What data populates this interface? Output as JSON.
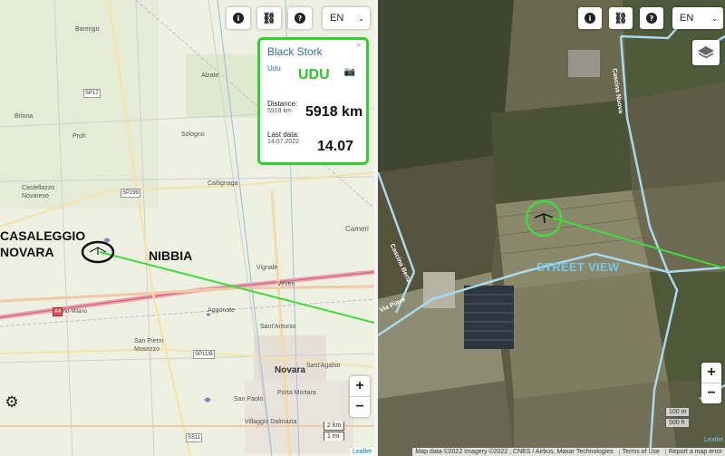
{
  "left_map": {
    "controls": {
      "lang": "EN",
      "zoom_in": "+",
      "zoom_out": "−"
    },
    "places": {
      "barengo": "Barengo",
      "alzate": "Alzate",
      "briona": "Briona",
      "proh": "Proh",
      "sologno": "Sologno",
      "caltignaga": "Caltignaga",
      "castellazzo": "Castellazzo\nNovarese",
      "vignale": "Vignale",
      "veveri": "Veveri",
      "aggonate": "Aggonate",
      "santantonio": "Sant'Antonio",
      "sanpietro": "San Pietro\nMosezzo",
      "novara": "Novara",
      "santagabio": "Sant'Agabio",
      "sanpaolo": "San Paolo",
      "portamortara": "Porta Mortara",
      "villaggio": "Villaggio Dalmazia",
      "cameri": "Cameri",
      "torino_milano": "Torino-Milano"
    },
    "roads": {
      "sp17": "SP17",
      "sp299": "SP299",
      "a4": "A4",
      "sp11b": "SP11/B",
      "ss11": "SS11"
    },
    "overlay": {
      "casaleggio": "CASALEGGIO\nNOVARA",
      "nibbia": "NIBBIA"
    },
    "scale": {
      "km": "2 km",
      "mi": "1 mi"
    },
    "attribution": "Leaflet"
  },
  "popup": {
    "name": "Black Stork",
    "id": "Udu",
    "big_name": "UDU",
    "distance_label": "Distance:",
    "distance_small": "5918 km",
    "distance_big": "5918 km",
    "lastdata_label": "Last data:",
    "lastdata_small": "14.07.2022",
    "lastdata_big": "14.07",
    "close": "×"
  },
  "right_map": {
    "controls": {
      "lang": "EN",
      "zoom_in": "+",
      "zoom_out": "−"
    },
    "streets": {
      "cascina_nuova": "Cascina Nuova",
      "cascina_berta": "Cascina Berta",
      "via_piave": "Via Piave"
    },
    "overlay": {
      "street_view": "STREET VIEW"
    },
    "scale": {
      "m": "100 m",
      "ft": "500 ft"
    },
    "attribution": {
      "leaflet": "Leaflet",
      "data": "Map data ©2022 Imagery ©2022 , CNES / Airbus, Maxar Technologies",
      "terms": "Terms of Use",
      "report": "Report a map error"
    }
  },
  "colors": {
    "track_green": "#3ddc3d",
    "popup_border": "#2bd42b",
    "road_blue": "#a9d9ec"
  }
}
